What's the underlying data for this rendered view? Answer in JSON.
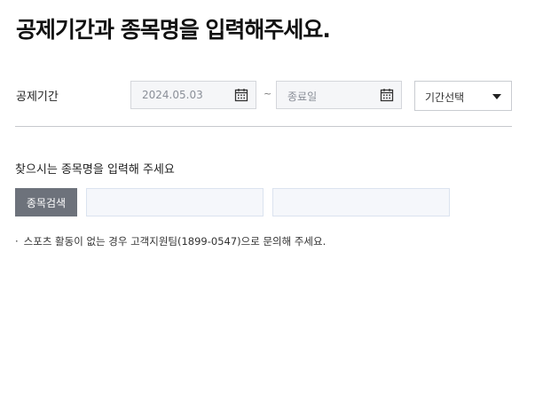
{
  "page": {
    "title": "공제기간과 종목명을 입력해주세요."
  },
  "period": {
    "label": "공제기간",
    "start_value": "2024.05.03",
    "separator": "~",
    "end_placeholder": "종료일",
    "select_value": "기간선택"
  },
  "search": {
    "guide": "찾으시는 종목명을 입력해 주세요",
    "button_label": "종목검색",
    "code_value": "",
    "name_value": ""
  },
  "notice": {
    "bullet": "·",
    "text": "스포츠 활동이 없는 경우 고객지원팀(1899-0547)으로 문의해 주세요."
  },
  "colors": {
    "button_bg": "#6d727b",
    "input_bg": "#f5f6f8",
    "divider": "#c7c9cd"
  },
  "icons": {
    "calendar": "calendar-icon",
    "dropdown": "chevron-down-icon"
  }
}
